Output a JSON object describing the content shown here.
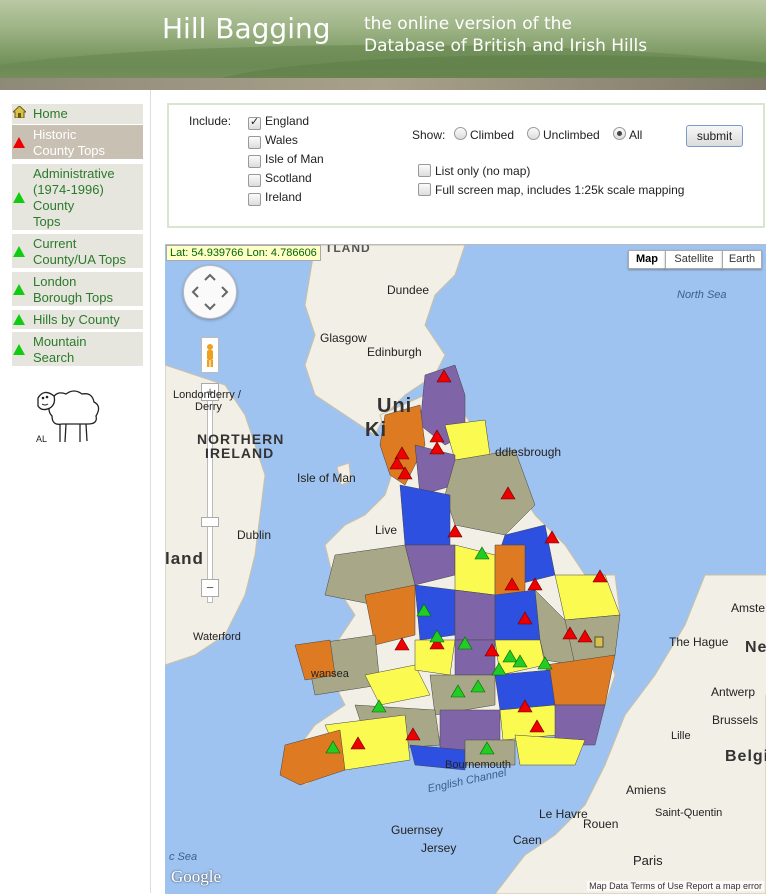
{
  "header": {
    "site_title": "Hill Bagging",
    "tagline_line1": "the online version of the",
    "tagline_line2": "Database of British and Irish Hills"
  },
  "sidebar": {
    "items": [
      {
        "label": "Home",
        "icon": "home-icon"
      },
      {
        "label_lines": [
          "Historic",
          "County Tops"
        ],
        "icon": "red-triangle-icon",
        "active": true
      },
      {
        "label_lines": [
          "Administrative",
          "(1974-1996)",
          "County",
          "Tops"
        ],
        "icon": "green-triangle-icon"
      },
      {
        "label_lines": [
          "Current",
          "County/UA Tops"
        ],
        "icon": "green-triangle-icon"
      },
      {
        "label_lines": [
          "London",
          "Borough Tops"
        ],
        "icon": "green-triangle-icon"
      },
      {
        "label": "Hills by County",
        "icon": "green-triangle-icon"
      },
      {
        "label_lines": [
          "Mountain",
          "Search"
        ],
        "icon": "green-triangle-icon"
      }
    ],
    "sheep_caption": "AL"
  },
  "filters": {
    "include_label": "Include:",
    "countries": [
      {
        "label": "England",
        "checked": true
      },
      {
        "label": "Wales",
        "checked": false
      },
      {
        "label": "Isle of Man",
        "checked": false
      },
      {
        "label": "Scotland",
        "checked": false
      },
      {
        "label": "Ireland",
        "checked": false
      }
    ],
    "show_label": "Show:",
    "show_options": [
      {
        "label": "Climbed",
        "selected": false
      },
      {
        "label": "Unclimbed",
        "selected": false
      },
      {
        "label": "All",
        "selected": true
      }
    ],
    "submit_label": "submit",
    "list_only_label": "List only (no map)",
    "full_screen_label": "Full screen map, includes 1:25k scale mapping"
  },
  "map": {
    "coords_readout": "Lat: 54.939766 Lon: 4.786606",
    "map_types": [
      {
        "label": "Map",
        "selected": true
      },
      {
        "label": "Satellite",
        "selected": false
      },
      {
        "label": "Earth",
        "selected": false
      }
    ],
    "labels": {
      "dundee": "Dundee",
      "north_sea": "North Sea",
      "glasgow": "Glasgow",
      "edinburgh": "Edinburgh",
      "united_frag1": "Uni",
      "united_frag2": "Ki",
      "londonderry1": "Londonderry /",
      "londonderry2": "Derry",
      "northern": "NORTHERN",
      "ireland_label": "IRELAND",
      "isle_of_man": "Isle of Man",
      "middlesbrough": "ddlesbrough",
      "liverpool": "Live",
      "dublin": "Dublin",
      "ireland_big": "land",
      "waterford": "Waterford",
      "the_hague": "The Hague",
      "amsterdam": "Amste",
      "ne_frag": "Ne",
      "antwerp": "Antwerp",
      "brussels": "Brussels",
      "lille": "Lille",
      "belgium": "Belgi",
      "english_channel": "English Channel",
      "amiens": "Amiens",
      "saint_quentin": "Saint-Quentin",
      "guernsey": "Guernsey",
      "jersey": "Jersey",
      "le_havre": "Le Havre",
      "rouen": "Rouen",
      "caen": "Caen",
      "paris": "Paris",
      "celtic_sea": "c Sea",
      "scotland_frag": "TLAND",
      "swansea": "wansea",
      "bournemouth": "Bournemouth"
    },
    "google_logo": "Google",
    "attribution": "Map Data  Terms of Use  Report a map error",
    "colors": {
      "sea": "#9fc3f0",
      "land": "#f2efe6",
      "purple": "#8064a8",
      "blue": "#2d50e0",
      "olive": "#a8a888",
      "orange": "#dd7a22",
      "yellow": "#fafa50",
      "marker_red": "#ee0000",
      "marker_green": "#22cc22"
    }
  }
}
